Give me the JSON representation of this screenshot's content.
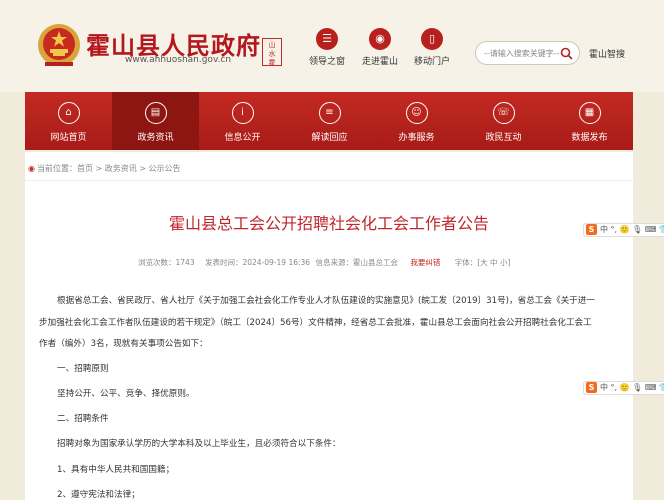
{
  "header": {
    "site_title": "霍山县人民政府",
    "site_url": "www.ahhuoshan.gov.cn",
    "seal_text": "山水霍",
    "links": [
      {
        "label": "领导之窗",
        "icon": "leader-icon"
      },
      {
        "label": "走进霍山",
        "icon": "location-icon"
      },
      {
        "label": "移动门户",
        "icon": "mobile-icon"
      }
    ],
    "search_placeholder": "--请输入搜索关键字--",
    "smart_label": "霍山智搜"
  },
  "nav": {
    "items": [
      {
        "label": "网站首页",
        "icon": "home-icon"
      },
      {
        "label": "政务资讯",
        "icon": "news-icon",
        "active": true
      },
      {
        "label": "信息公开",
        "icon": "info-icon"
      },
      {
        "label": "解读回应",
        "icon": "interpret-icon"
      },
      {
        "label": "办事服务",
        "icon": "service-icon"
      },
      {
        "label": "政民互动",
        "icon": "interact-icon"
      },
      {
        "label": "数据发布",
        "icon": "data-icon"
      }
    ]
  },
  "breadcrumb": {
    "prefix": "当前位置：",
    "path": "首页 > 政务资讯 > 公示公告"
  },
  "article": {
    "title": "霍山县总工会公开招聘社会化工会工作者公告",
    "views": "浏览次数：1743",
    "published": "发表时间：2024-09-19 16:36",
    "source": "信息来源：霍山县总工会",
    "error_link": "我要纠错",
    "font_size": "字体：[大 中 小]",
    "lines": [
      "根据省总工会、省民政厅、省人社厅《关于加强工会社会化工作专业人才队伍建设的实施意见》(皖工发〔2019〕31号)，省总工会《关于进一",
      "步加强社会化工会工作者队伍建设的若干规定》（皖工〔2024〕56号）文件精神，经省总工会批准，霍山县总工会面向社会公开招聘社会化工会工",
      "作者（编外）3名，现就有关事项公告如下：",
      "一、招聘原则",
      "坚持公开、公平、竞争、择优原则。",
      "二、招聘条件",
      "招聘对象为国家承认学历的大学本科及以上毕业生，且必须符合以下条件：",
      "1、具有中华人民共和国国籍；",
      "2、遵守宪法和法律；"
    ]
  },
  "float_toolbar": {
    "text": "中 °, 🙂 🎙 ⌨ 👕 ⠿"
  },
  "colors": {
    "brand_red": "#c32a22",
    "title_red": "#c0272d",
    "page_bg": "#f1ebdc"
  }
}
